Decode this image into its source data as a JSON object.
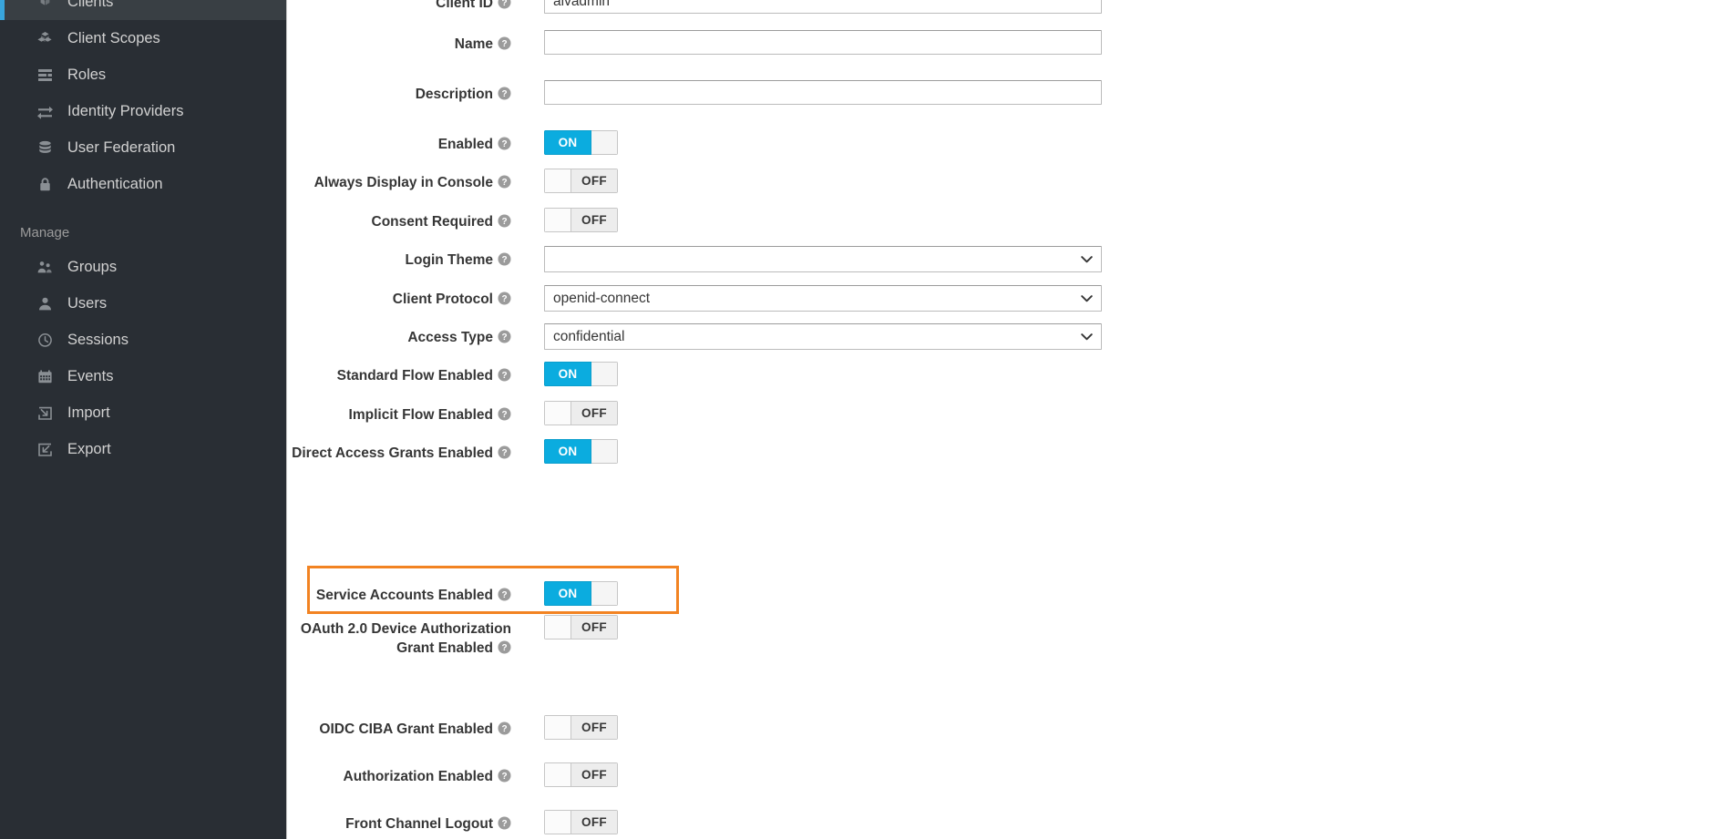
{
  "sidebar": {
    "partial_item": {
      "label": "Clients",
      "icon": "cubes-icon",
      "active": true
    },
    "configure_items": [
      {
        "label": "Client Scopes",
        "icon": "cubes-icon"
      },
      {
        "label": "Roles",
        "icon": "list-icon"
      },
      {
        "label": "Identity Providers",
        "icon": "exchange-icon"
      },
      {
        "label": "User Federation",
        "icon": "database-icon"
      },
      {
        "label": "Authentication",
        "icon": "lock-icon"
      }
    ],
    "manage_title": "Manage",
    "manage_items": [
      {
        "label": "Groups",
        "icon": "users-group-icon"
      },
      {
        "label": "Users",
        "icon": "user-icon"
      },
      {
        "label": "Sessions",
        "icon": "clock-icon"
      },
      {
        "label": "Events",
        "icon": "calendar-icon"
      },
      {
        "label": "Import",
        "icon": "import-arrow-icon"
      },
      {
        "label": "Export",
        "icon": "export-arrow-icon"
      }
    ],
    "accent_color": "#39a5dc",
    "background_color": "#292e34"
  },
  "form": {
    "rows": [
      {
        "label": "Client ID",
        "type": "text",
        "value": "aivadmin",
        "placeholder": ""
      },
      {
        "label": "Name",
        "type": "text",
        "value": "",
        "placeholder": ""
      },
      {
        "label": "Description",
        "type": "text",
        "value": "",
        "placeholder": ""
      },
      {
        "label": "Enabled",
        "type": "toggle",
        "value": "ON"
      },
      {
        "label": "Always Display in Console",
        "type": "toggle",
        "value": "OFF"
      },
      {
        "label": "Consent Required",
        "type": "toggle",
        "value": "OFF"
      },
      {
        "label": "Login Theme",
        "type": "select",
        "value": ""
      },
      {
        "label": "Client Protocol",
        "type": "select",
        "value": "openid-connect"
      },
      {
        "label": "Access Type",
        "type": "select",
        "value": "confidential"
      },
      {
        "label": "Standard Flow Enabled",
        "type": "toggle",
        "value": "ON"
      },
      {
        "label": "Implicit Flow Enabled",
        "type": "toggle",
        "value": "OFF"
      },
      {
        "label": "Direct Access Grants Enabled",
        "type": "toggle",
        "value": "ON"
      },
      {
        "label": "Service Accounts Enabled",
        "type": "toggle",
        "value": "ON",
        "highlighted": true
      },
      {
        "label": "OAuth 2.0 Device Authorization Grant Enabled",
        "type": "toggle",
        "value": "OFF"
      },
      {
        "label": "OIDC CIBA Grant Enabled",
        "type": "toggle",
        "value": "OFF"
      },
      {
        "label": "Authorization Enabled",
        "type": "toggle",
        "value": "OFF"
      },
      {
        "label": "Front Channel Logout",
        "type": "toggle",
        "value": "OFF"
      }
    ],
    "toggle_on_label": "ON",
    "toggle_off_label": "OFF",
    "help_icon": "question-circle-icon",
    "highlight_color": "#f28322"
  }
}
